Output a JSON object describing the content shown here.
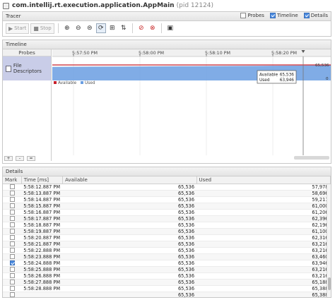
{
  "window": {
    "title": "com.intellij.rt.execution.application.AppMain",
    "pid": "(pid 12124)"
  },
  "tracer": {
    "header": "Tracer",
    "options": [
      {
        "label": "Probes",
        "checked": false
      },
      {
        "label": "Timeline",
        "checked": true
      },
      {
        "label": "Details",
        "checked": true
      }
    ],
    "start_label": "Start",
    "stop_label": "Stop",
    "icons": [
      "zoom-in-icon",
      "zoom-out-icon",
      "zoom-fit-icon",
      "select-mode-icon",
      "probe-settings-icon",
      "export-icon",
      "record-icon",
      "stop-record-icon",
      "snapshot-icon"
    ]
  },
  "timeline": {
    "header": "Timeline",
    "probes_header": "Probes",
    "probe_name": "File Descriptors",
    "zoom_buttons": [
      "+",
      "-",
      "="
    ]
  },
  "chart_data": {
    "type": "area",
    "title": "",
    "x_tick_labels": [
      "5:57:50 PM",
      "5:58:00 PM",
      "5:58:10 PM",
      "5:58:20 PM"
    ],
    "series": [
      {
        "name": "Available",
        "color": "#c8202c",
        "values": [
          65536,
          65536,
          65536,
          65536,
          65536
        ]
      },
      {
        "name": "Used",
        "color": "#6a9ee2",
        "values": [
          57500,
          59000,
          60500,
          62000,
          63946
        ]
      }
    ],
    "ylim": [
      0,
      65536
    ],
    "y_tick_labels": [
      "65,536",
      "0"
    ],
    "tooltip": {
      "available_label": "Available",
      "available_value": "65,536",
      "used_label": "Used",
      "used_value": "63,946"
    },
    "legend": "bottom-left",
    "grid": true
  },
  "details": {
    "header": "Details",
    "columns": [
      "Mark",
      "Time [ms]",
      "Available",
      "Used"
    ],
    "rows": [
      {
        "mark": false,
        "time": "5:58:12.887 PM",
        "available": "65,536",
        "used": "57,978"
      },
      {
        "mark": false,
        "time": "5:58:13.887 PM",
        "available": "65,536",
        "used": "58,696"
      },
      {
        "mark": false,
        "time": "5:58:14.887 PM",
        "available": "65,536",
        "used": "59,211"
      },
      {
        "mark": false,
        "time": "5:58:15.887 PM",
        "available": "65,536",
        "used": "61,000"
      },
      {
        "mark": false,
        "time": "5:58:16.887 PM",
        "available": "65,536",
        "used": "61,206"
      },
      {
        "mark": false,
        "time": "5:58:17.887 PM",
        "available": "65,536",
        "used": "62,396"
      },
      {
        "mark": false,
        "time": "5:58:18.887 PM",
        "available": "65,536",
        "used": "62,196"
      },
      {
        "mark": false,
        "time": "5:58:19.887 PM",
        "available": "65,536",
        "used": "61,100"
      },
      {
        "mark": false,
        "time": "5:58:20.887 PM",
        "available": "65,536",
        "used": "62,316"
      },
      {
        "mark": false,
        "time": "5:58:21.887 PM",
        "available": "65,536",
        "used": "63,216"
      },
      {
        "mark": false,
        "time": "5:58:22.888 PM",
        "available": "65,536",
        "used": "63,216"
      },
      {
        "mark": false,
        "time": "5:58:23.888 PM",
        "available": "65,536",
        "used": "63,460"
      },
      {
        "mark": true,
        "time": "5:58:24.888 PM",
        "available": "65,536",
        "used": "63,946"
      },
      {
        "mark": false,
        "time": "5:58:25.888 PM",
        "available": "65,536",
        "used": "63,216"
      },
      {
        "mark": false,
        "time": "5:58:26.888 PM",
        "available": "65,536",
        "used": "63,216"
      },
      {
        "mark": false,
        "time": "5:58:27.888 PM",
        "available": "65,536",
        "used": "65,188"
      },
      {
        "mark": false,
        "time": "5:58:28.888 PM",
        "available": "65,536",
        "used": "65,388"
      },
      {
        "mark": false,
        "time": "",
        "available": "65,536",
        "used": "65,388"
      }
    ]
  }
}
